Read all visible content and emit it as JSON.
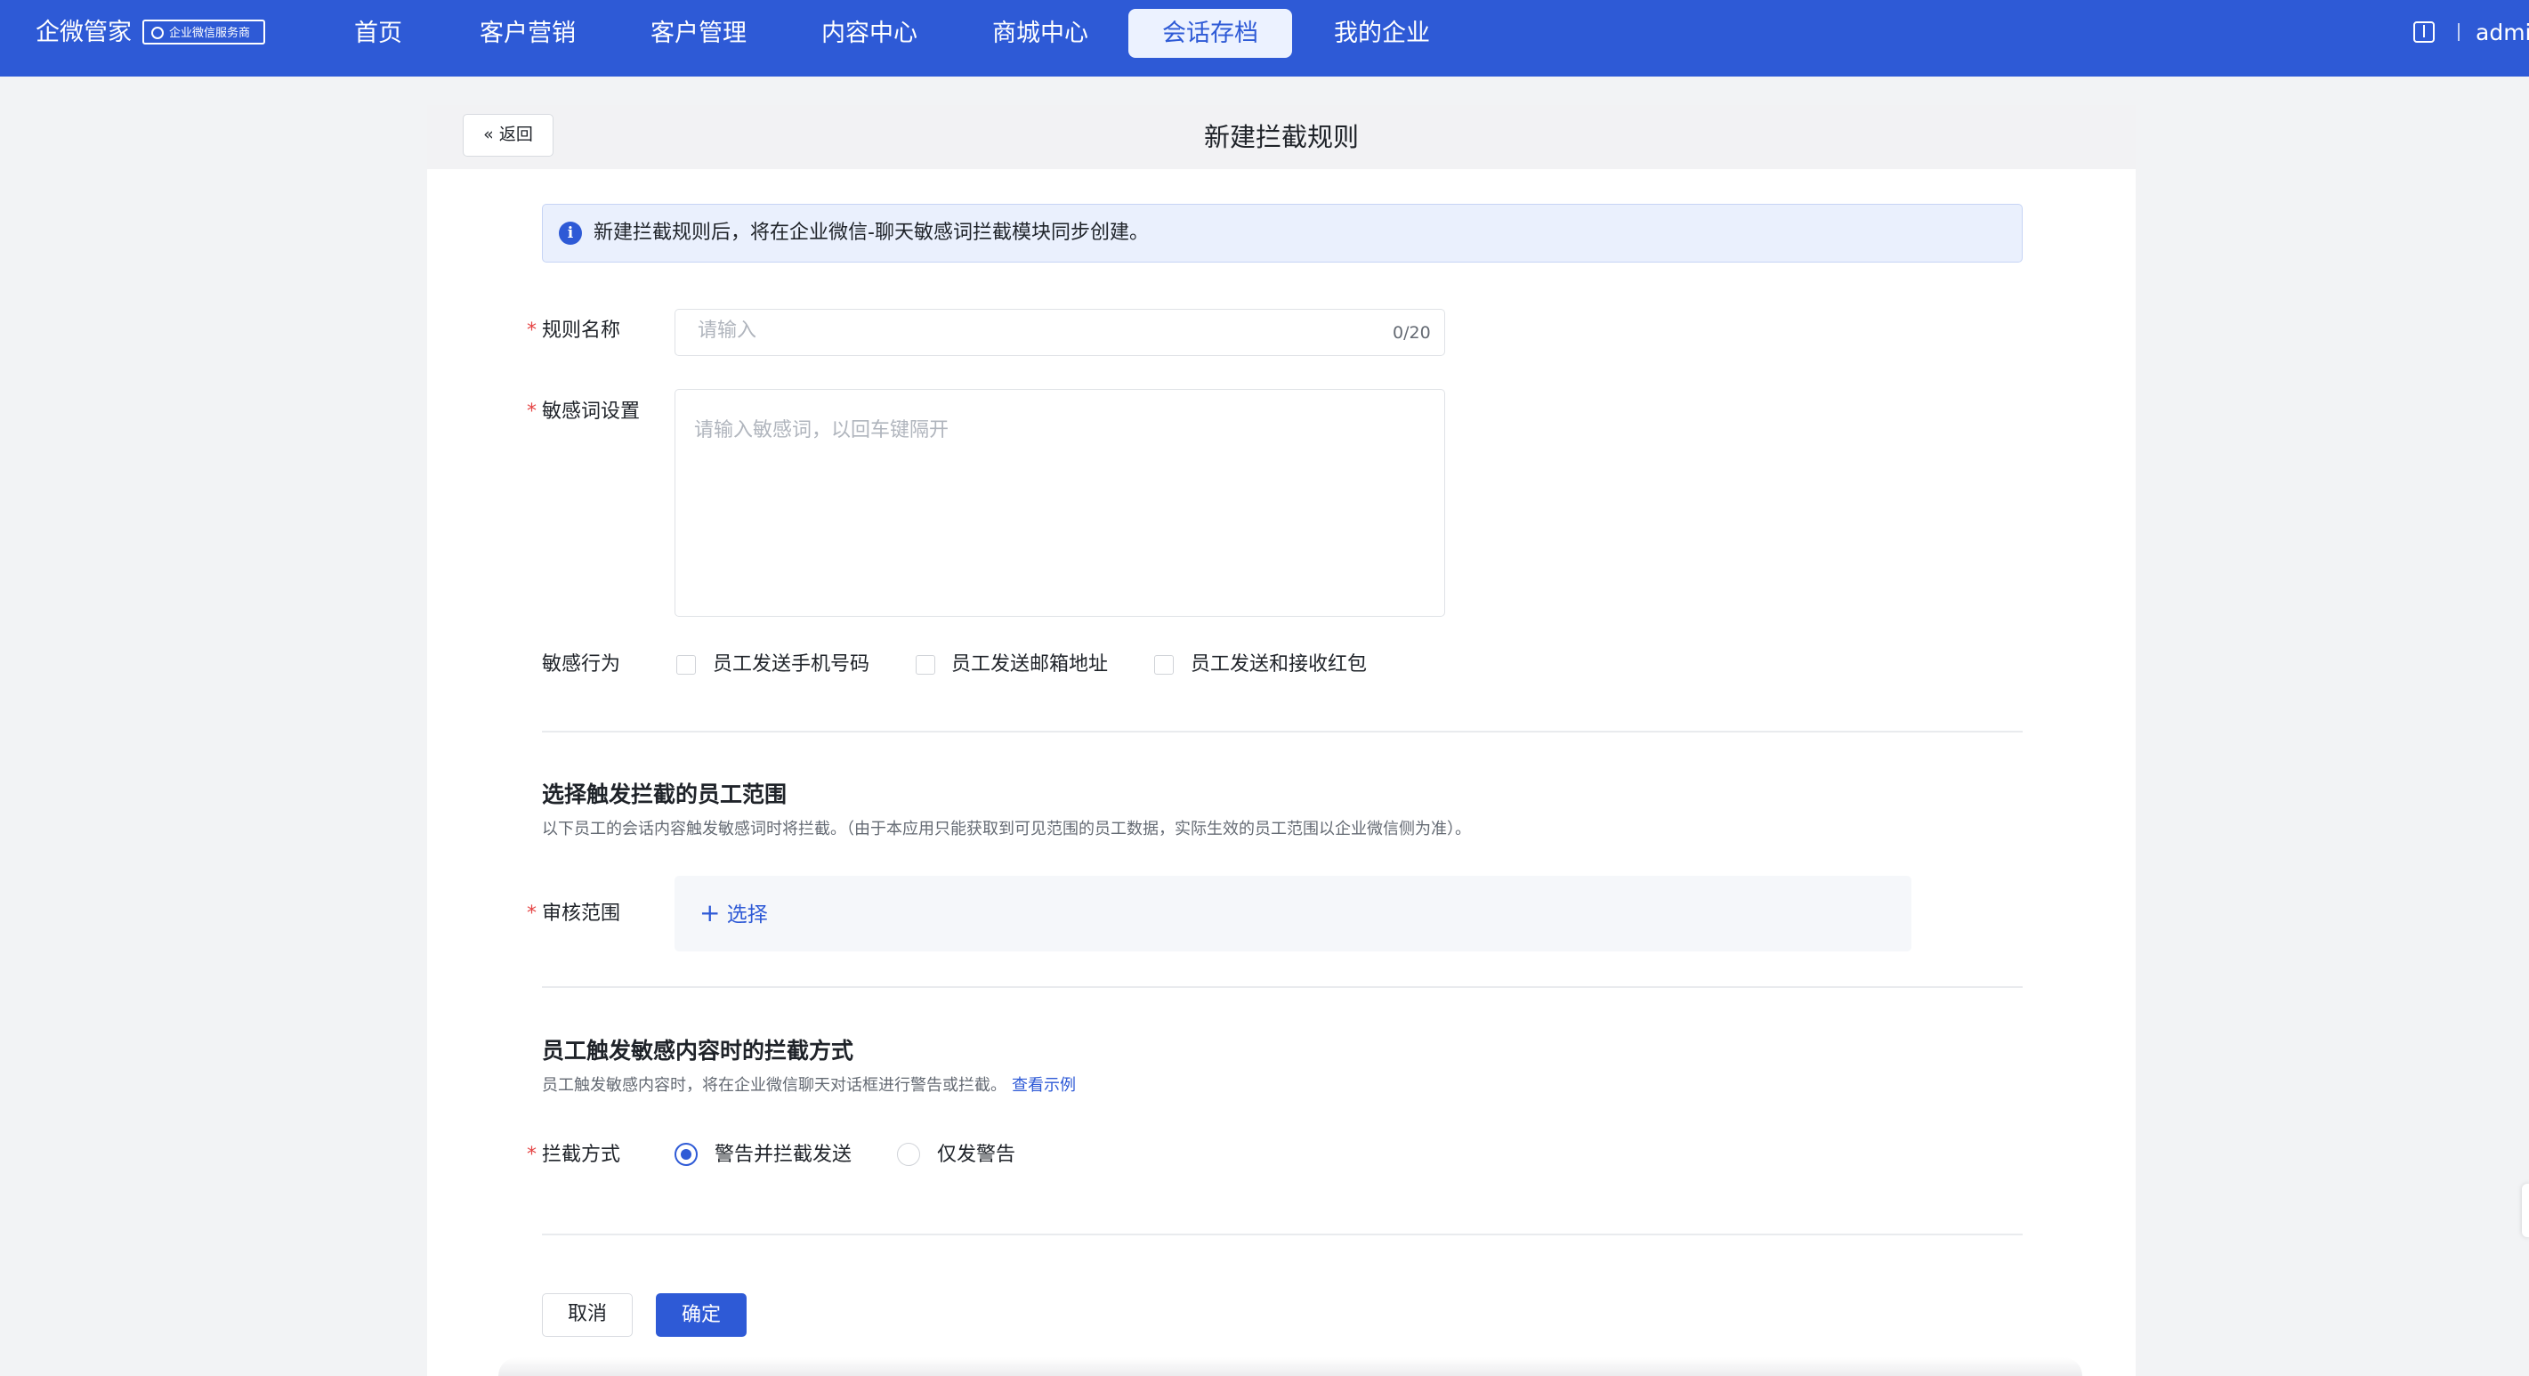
{
  "header": {
    "brand": "企微管家",
    "brand_badge": "企业微信服务商",
    "nav": [
      "首页",
      "客户营销",
      "客户管理",
      "内容中心",
      "商城中心",
      "会话存档",
      "我的企业"
    ],
    "active_nav": "会话存档",
    "user": "admin"
  },
  "page": {
    "back_label": "返回",
    "title": "新建拦截规则",
    "notice": "新建拦截规则后，将在企业微信-聊天敏感词拦截模块同步创建。"
  },
  "form": {
    "rule_name": {
      "label": "规则名称",
      "placeholder": "请输入",
      "value": "",
      "counter": "0/20"
    },
    "sensitive_words": {
      "label": "敏感词设置",
      "placeholder": "请输入敏感词，以回车键隔开",
      "value": ""
    },
    "sensitive_behavior": {
      "label": "敏感行为",
      "options": [
        {
          "label": "员工发送手机号码",
          "checked": false
        },
        {
          "label": "员工发送邮箱地址",
          "checked": false
        },
        {
          "label": "员工发送和接收红包",
          "checked": false
        }
      ]
    }
  },
  "scope_section": {
    "title": "选择触发拦截的员工范围",
    "subtitle": "以下员工的会话内容触发敏感词时将拦截。（由于本应用只能获取到可见范围的员工数据，实际生效的员工范围以企业微信侧为准）。",
    "field_label": "审核范围",
    "select_label": "选择"
  },
  "intercept_section": {
    "title": "员工触发敏感内容时的拦截方式",
    "subtitle": "员工触发敏感内容时，将在企业微信聊天对话框进行警告或拦截。",
    "example_link": "查看示例",
    "field_label": "拦截方式",
    "options": [
      {
        "label": "警告并拦截发送",
        "selected": true
      },
      {
        "label": "仅发警告",
        "selected": false
      }
    ]
  },
  "actions": {
    "cancel": "取消",
    "confirm": "确定"
  },
  "colors": {
    "primary": "#2e5ad6",
    "required": "#e54545"
  }
}
